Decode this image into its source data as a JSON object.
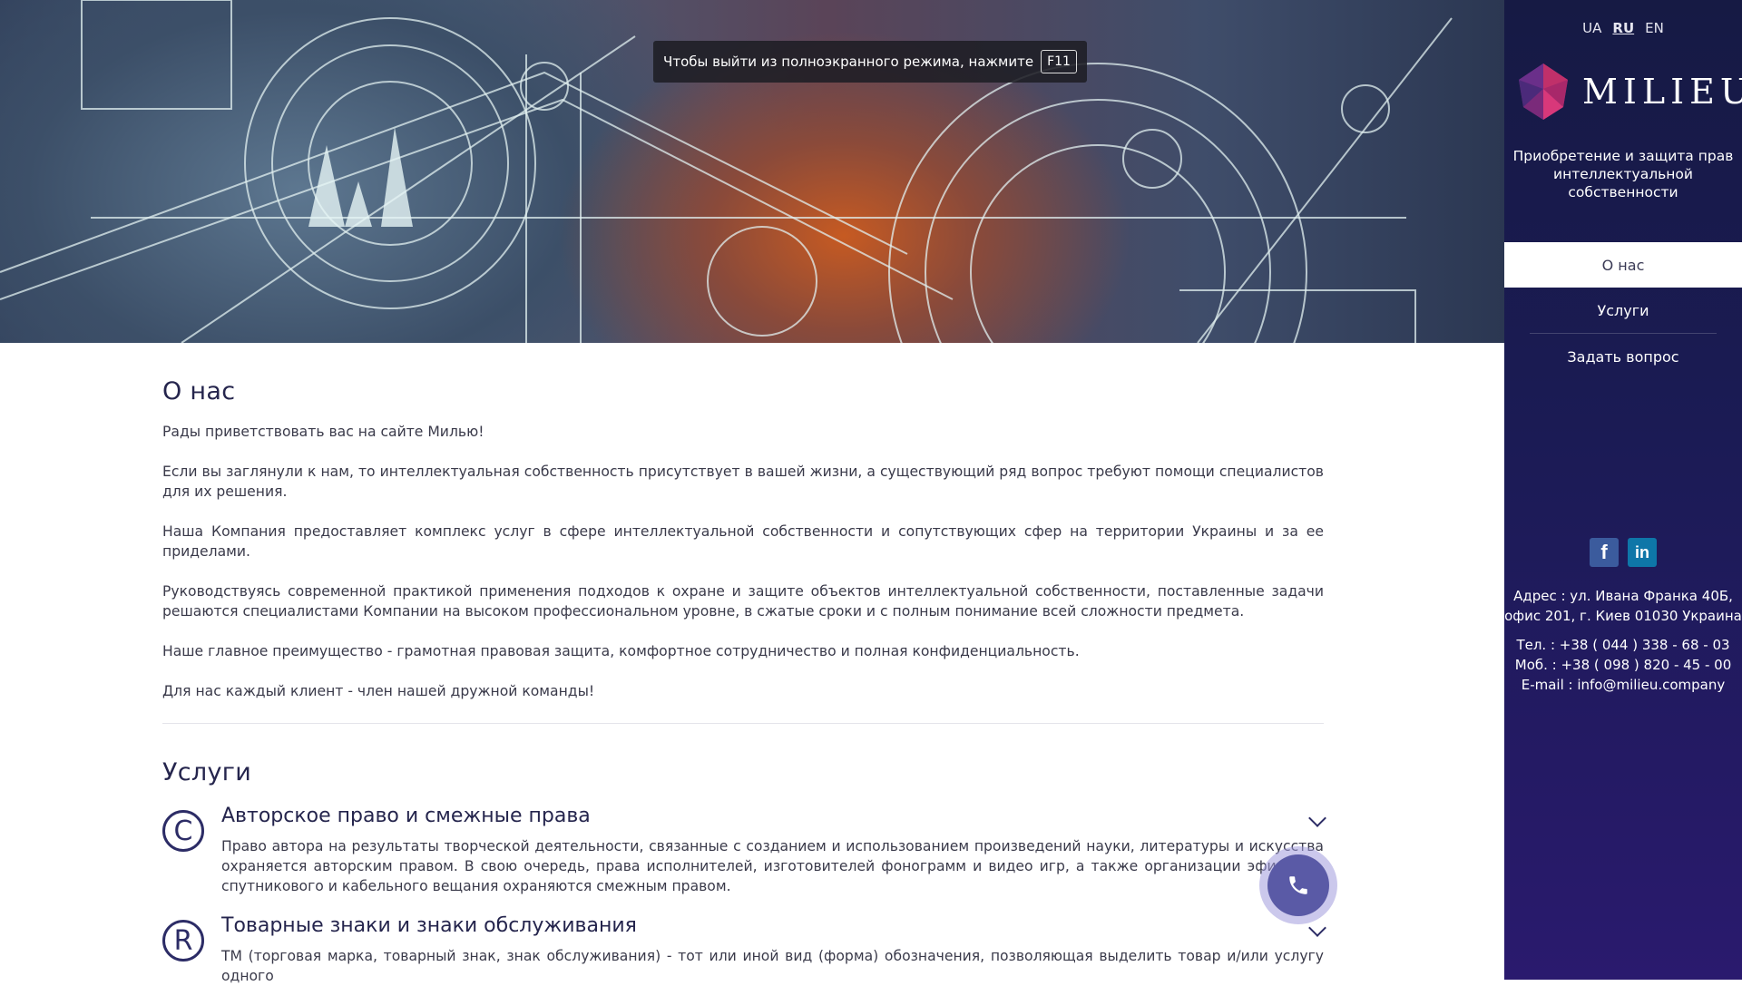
{
  "hero": {
    "fullscreen_notice": "Чтобы выйти из полноэкранного режима, нажмите",
    "fullscreen_key": "F11"
  },
  "about": {
    "title": "О нас",
    "paragraphs": [
      "Рады приветствовать вас на сайте Милью!",
      "Если вы заглянули к нам, то интеллектуальная собственность присутствует в вашей жизни, а существующий ряд вопрос требуют помощи специалистов для их решения.",
      "Наша Компания предоставляет комплекс услуг в сфере интеллектуальной собственности и сопутствующих сфер на территории Украины и за ее приделами.",
      "Руководствуясь современной практикой применения подходов к охране и защите объектов интеллектуальной собственности, поставленные задачи решаются специалистами Компании на высоком профессиональном уровне, в сжатые сроки и с полным понимание всей сложности предмета.",
      "Наше главное преимущество - грамотная правовая защита, комфортное сотрудничество и полная конфиденциальность.",
      "Для нас каждый клиент - член нашей дружной команды!"
    ]
  },
  "services": {
    "title": "Услуги",
    "items": [
      {
        "icon": "copyright-icon",
        "symbol": "C",
        "title": "Авторское право и смежные права",
        "text": "Право автора на результаты творческой деятельности, связанные с созданием и использованием произведений науки, литературы и искусства охраняется авторским правом. В свою очередь, права исполнителей, изготовителей фонограмм и видео игр, а также организации эфирного, спутникового и кабельного вещания охраняются смежным правом."
      },
      {
        "icon": "registered-trademark-icon",
        "symbol": "R",
        "title": "Товарные знаки и знаки обслуживания",
        "text": "ТМ (торговая марка, товарный знак, знак обслуживания) - тот или иной вид (форма) обозначения, позволяющая выделить товар и/или услугу одного"
      }
    ]
  },
  "sidebar": {
    "languages": [
      "UA",
      "RU",
      "EN"
    ],
    "active_language": "RU",
    "logo_text": "MILIEU",
    "tagline": "Приобретение и защита прав интеллектуальной собственности",
    "nav": [
      "О нас",
      "Услуги",
      "Задать вопрос"
    ],
    "active_nav": "О нас",
    "social": [
      "facebook-icon",
      "linkedin-icon"
    ],
    "address_line1": "Адрес : ул. Ивана Франка 40Б,",
    "address_line2": "офис 201, г. Киев 01030 Украина",
    "phone": "Тел. : +38 ( 044 ) 338 - 68 - 03",
    "mobile": "Моб. : +38 ( 098 ) 820 - 45 - 00",
    "email": "E-mail : info@milieu.company"
  },
  "colors": {
    "sidebar_bg": "#1b1b55",
    "heading": "#25254d",
    "call_button": "#5a5aa6"
  }
}
